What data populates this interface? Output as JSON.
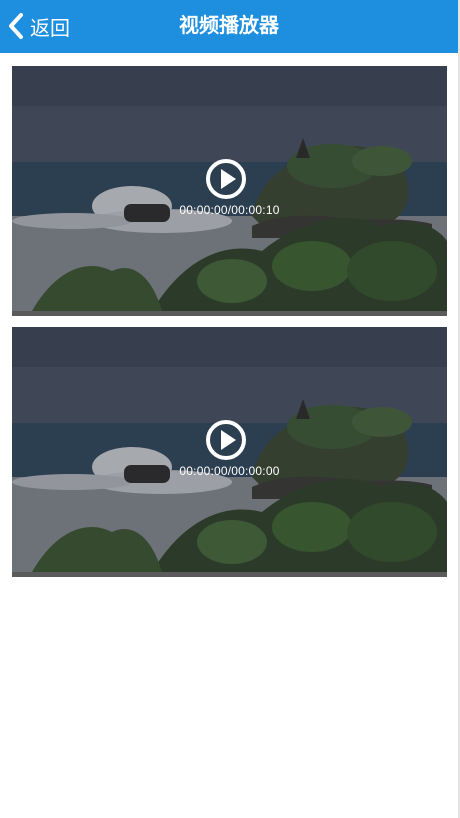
{
  "header": {
    "back_label": "返回",
    "title": "视频播放器"
  },
  "videos": [
    {
      "time": "00:00:00/00:00:10",
      "progress": 0
    },
    {
      "time": "00:00:00/00:00:00",
      "progress": 0
    }
  ],
  "icons": {
    "back": "chevron-left-icon",
    "play": "play-circle-icon"
  },
  "colors": {
    "header_bg": "#1e8ede",
    "text_on_header": "#ffffff"
  }
}
